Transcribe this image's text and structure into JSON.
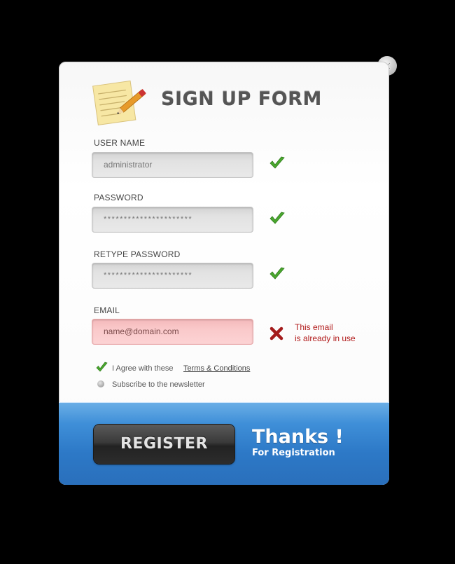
{
  "form": {
    "title": "SIGN UP FORM",
    "fields": [
      {
        "label": "USER NAME",
        "value": "administrator",
        "status": "valid"
      },
      {
        "label": "PASSWORD",
        "value": "**********************",
        "status": "valid"
      },
      {
        "label": "RETYPE PASSWORD",
        "value": "**********************",
        "status": "valid"
      },
      {
        "label": "EMAIL",
        "value": "name@domain.com",
        "status": "error"
      }
    ],
    "email_error_line1": "This email",
    "email_error_line2": "is already in use",
    "agree_text": "I Agree with these",
    "terms_link": "Terms & Conditions",
    "newsletter_text": "Subscribe to the newsletter"
  },
  "footer": {
    "register_label": "REGISTER",
    "thanks_title": "Thanks !",
    "thanks_subtitle": "For Registration"
  },
  "colors": {
    "accent_blue": "#3f8fd8",
    "valid_green": "#4aa82e",
    "error_red": "#b01818"
  },
  "icons": [
    "close-icon",
    "notepad-pencil-icon",
    "checkmark-icon",
    "error-x-icon",
    "radio-icon"
  ]
}
